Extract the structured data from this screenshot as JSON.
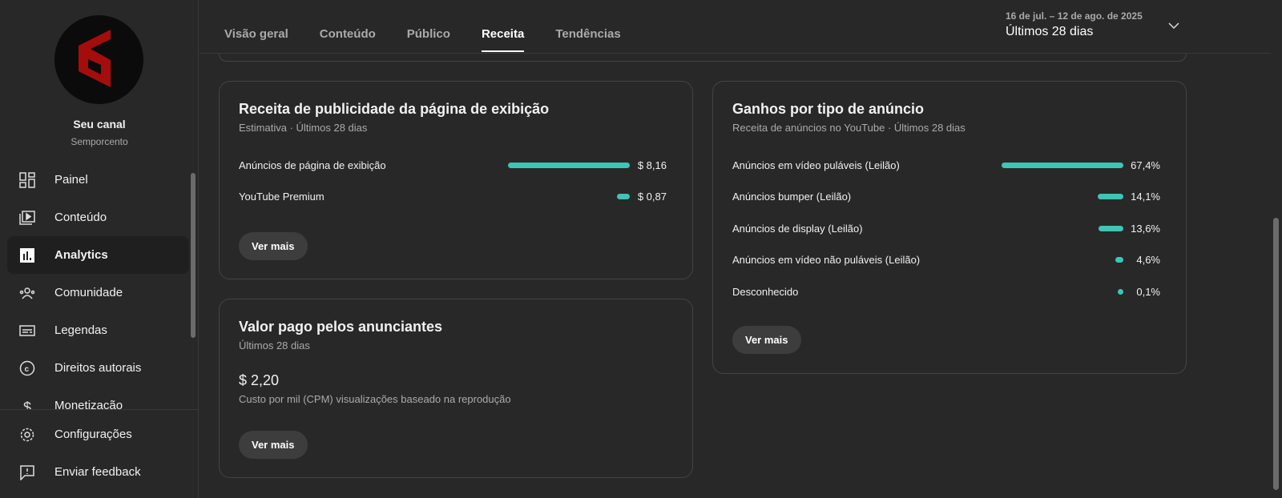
{
  "sidebar": {
    "channel_title": "Seu canal",
    "channel_name": "Semporcento",
    "items": [
      {
        "label": "Painel",
        "icon": "dashboard-icon"
      },
      {
        "label": "Conteúdo",
        "icon": "content-icon"
      },
      {
        "label": "Analytics",
        "icon": "analytics-icon"
      },
      {
        "label": "Comunidade",
        "icon": "community-icon"
      },
      {
        "label": "Legendas",
        "icon": "subtitles-icon"
      },
      {
        "label": "Direitos autorais",
        "icon": "copyright-icon"
      },
      {
        "label": "Monetização",
        "icon": "dollar-icon"
      }
    ],
    "footer": [
      {
        "label": "Configurações",
        "icon": "gear-icon"
      },
      {
        "label": "Enviar feedback",
        "icon": "feedback-icon"
      }
    ]
  },
  "tabs": [
    "Visão geral",
    "Conteúdo",
    "Público",
    "Receita",
    "Tendências"
  ],
  "active_tab": "Receita",
  "date": {
    "range": "16 de jul. – 12 de ago. de 2025",
    "label": "Últimos 28 dias"
  },
  "accent": "#3ec5b6",
  "watch_page": {
    "title": "Receita de publicidade da página de exibição",
    "subtitle": "Estimativa · Últimos 28 dias",
    "rows": [
      {
        "label": "Anúncios de página de exibição",
        "value": 8.16,
        "display": "$ 8,16"
      },
      {
        "label": "YouTube Premium",
        "value": 0.87,
        "display": "$ 0,87"
      }
    ],
    "button": "Ver mais"
  },
  "advertisers": {
    "title": "Valor pago pelos anunciantes",
    "subtitle": "Últimos 28 dias",
    "value": "$ 2,20",
    "caption": "Custo por mil (CPM) visualizações baseado na reprodução",
    "button": "Ver mais"
  },
  "ad_types": {
    "title": "Ganhos por tipo de anúncio",
    "subtitle": "Receita de anúncios no YouTube · Últimos 28 dias",
    "rows": [
      {
        "label": "Anúncios em vídeo puláveis (Leilão)",
        "value": 67.4,
        "display": "67,4%"
      },
      {
        "label": "Anúncios bumper (Leilão)",
        "value": 14.1,
        "display": "14,1%"
      },
      {
        "label": "Anúncios de display (Leilão)",
        "value": 13.6,
        "display": "13,6%"
      },
      {
        "label": "Anúncios em vídeo não puláveis (Leilão)",
        "value": 4.6,
        "display": "4,6%"
      },
      {
        "label": "Desconhecido",
        "value": 0.1,
        "display": "0,1%"
      }
    ],
    "button": "Ver mais"
  }
}
